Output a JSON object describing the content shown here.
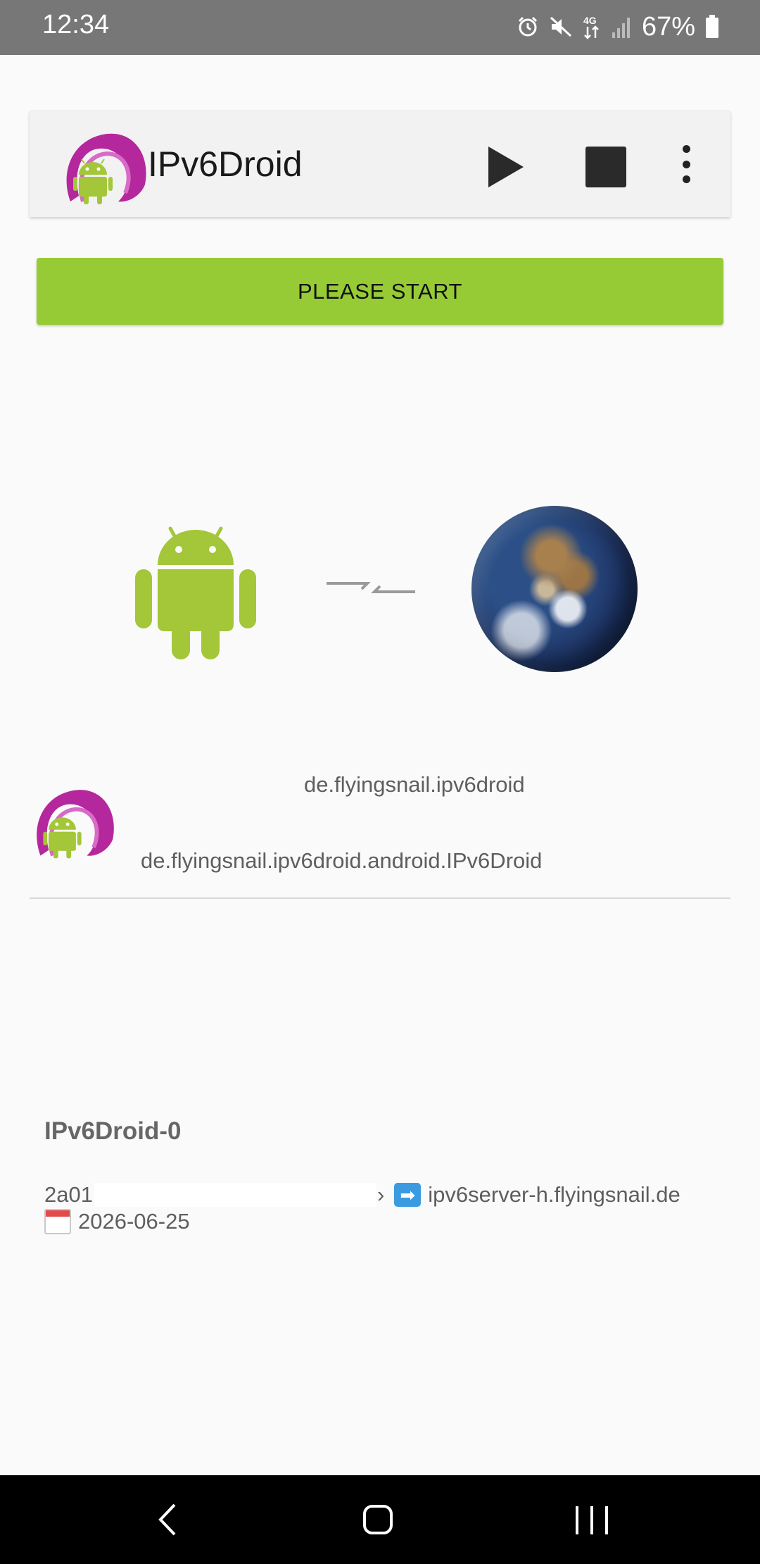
{
  "status_bar": {
    "time": "12:34",
    "battery": "67%",
    "network": "4G",
    "icons": [
      "alarm-icon",
      "mute-icon",
      "network-4g-icon",
      "signal-icon",
      "battery-icon"
    ]
  },
  "toolbar": {
    "title": "IPv6Droid",
    "play_icon": "play-icon",
    "stop_icon": "stop-icon",
    "more_icon": "more-vert-icon"
  },
  "start_button": {
    "label": "PLEASE START",
    "color": "#96cb36"
  },
  "connection": {
    "device_icon": "android-icon",
    "link_icon": "disconnected-arrows-icon",
    "remote_icon": "globe-icon"
  },
  "package": {
    "name": "de.flyingsnail.ipv6droid",
    "activity": "de.flyingsnail.ipv6droid.android.IPv6Droid"
  },
  "tunnel": {
    "title": "IPv6Droid-0",
    "address_prefix": "2a01",
    "address_suffix": "›",
    "arrow": "➡",
    "server": "ipv6server-h.flyingsnail.de",
    "date": "2026-06-25"
  },
  "nav_bar": {
    "back_icon": "back-icon",
    "home_icon": "home-icon",
    "recents_icon": "recents-icon"
  },
  "colors": {
    "accent_green": "#96cb36",
    "android_green": "#a4c639",
    "logo_magenta": "#b5279c"
  }
}
